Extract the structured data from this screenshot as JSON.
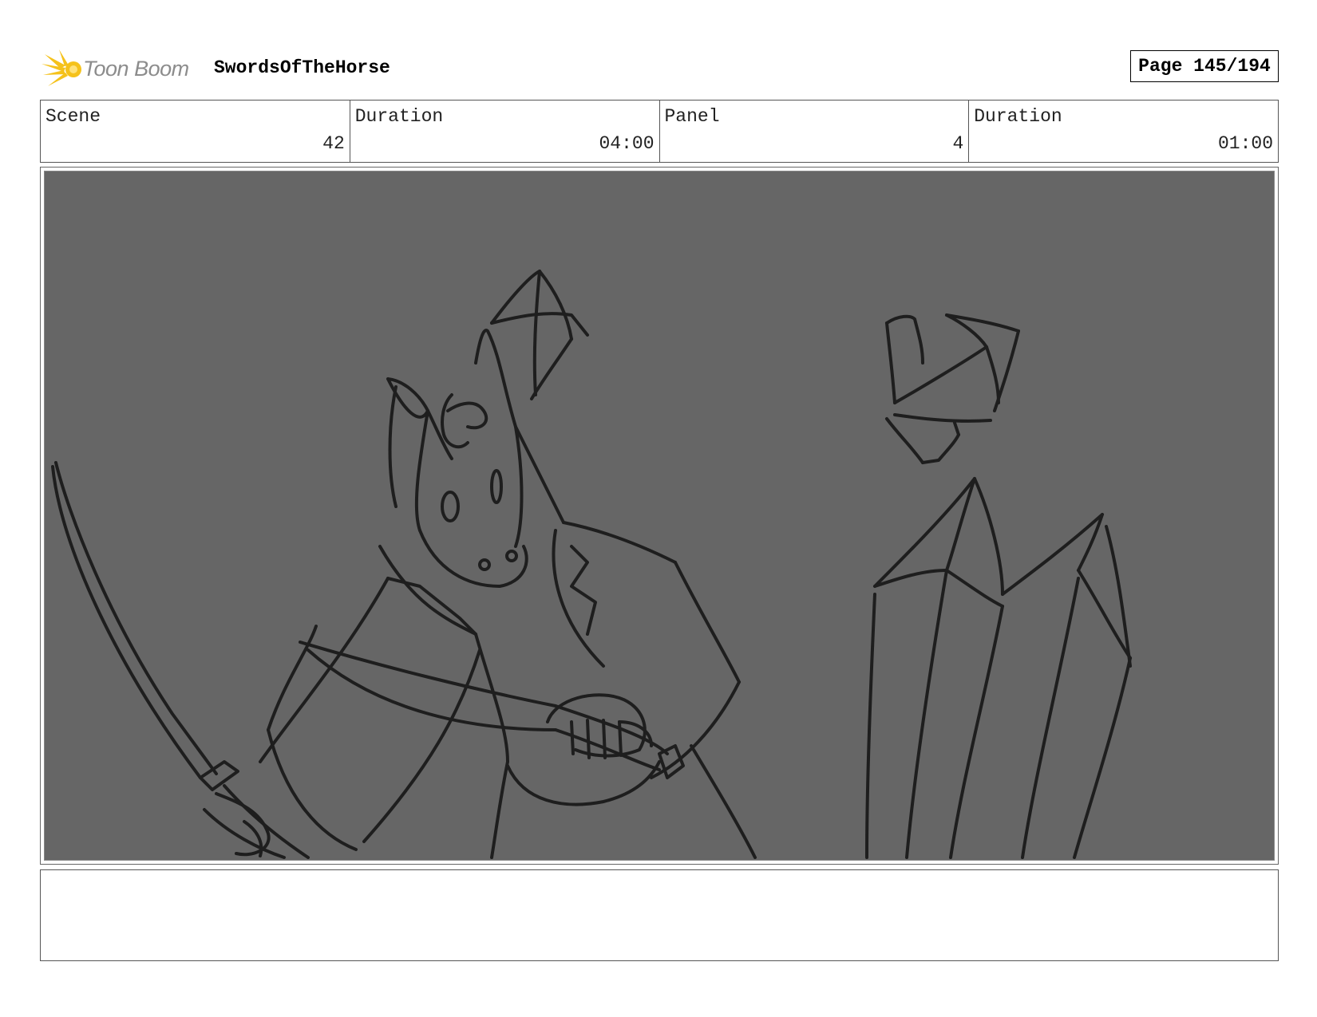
{
  "header": {
    "logo_text": "Toon Boom",
    "project_title": "SwordsOfTheHorse",
    "page_label": "Page 145/194"
  },
  "info": [
    {
      "label": "Scene",
      "value": "42"
    },
    {
      "label": "Duration",
      "value": "04:00"
    },
    {
      "label": "Panel",
      "value": "4"
    },
    {
      "label": "Duration",
      "value": "01:00"
    }
  ],
  "colors": {
    "logo_accent": "#f5c21b",
    "frame_background": "#666666",
    "sketch_stroke": "#1e1e1e"
  },
  "notes": ""
}
